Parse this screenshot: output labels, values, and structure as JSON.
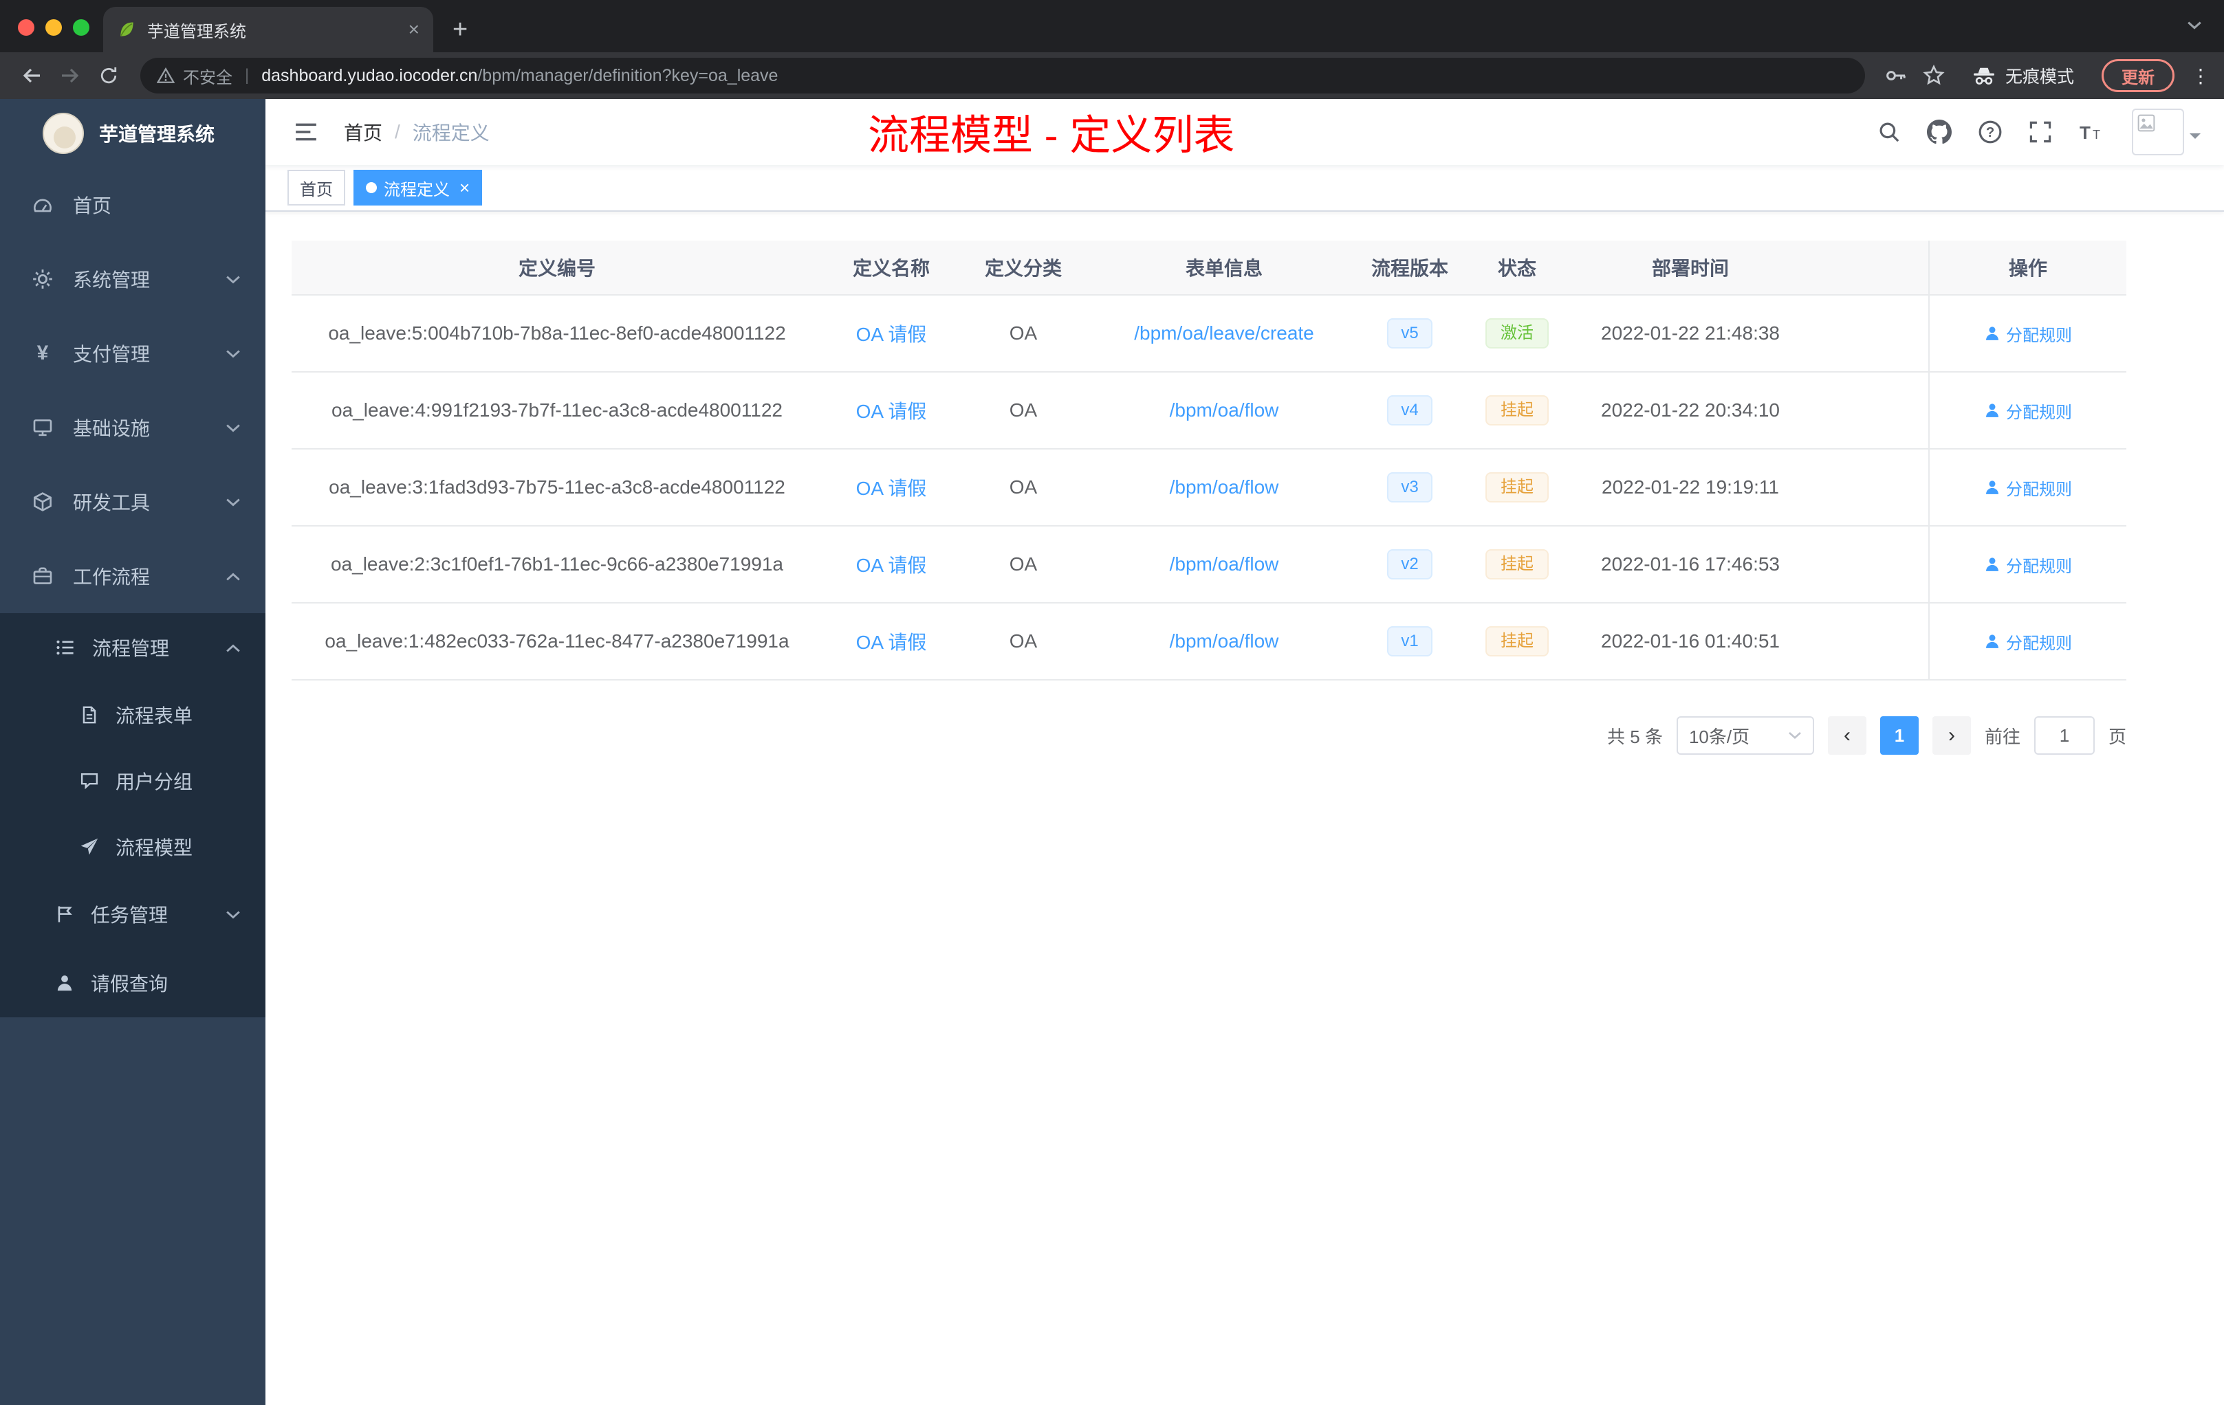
{
  "browser": {
    "tab_title": "芋道管理系统",
    "url_security": "不安全",
    "url_host": "dashboard.yudao.iocoder.cn",
    "url_path": "/bpm/manager/definition?key=oa_leave",
    "incognito_label": "无痕模式",
    "update_label": "更新"
  },
  "sidebar": {
    "logo": "芋道管理系统",
    "items": [
      {
        "label": "首页"
      },
      {
        "label": "系统管理"
      },
      {
        "label": "支付管理"
      },
      {
        "label": "基础设施"
      },
      {
        "label": "研发工具"
      },
      {
        "label": "工作流程"
      }
    ],
    "process_mgmt": "流程管理",
    "process_children": [
      "流程表单",
      "用户分组",
      "流程模型"
    ],
    "task_mgmt": "任务管理",
    "leave_query": "请假查询"
  },
  "header": {
    "breadcrumb_home": "首页",
    "breadcrumb_current": "流程定义",
    "title": "流程模型 - 定义列表"
  },
  "tags": [
    {
      "label": "首页",
      "active": false
    },
    {
      "label": "流程定义",
      "active": true
    }
  ],
  "table": {
    "columns": [
      "定义编号",
      "定义名称",
      "定义分类",
      "表单信息",
      "流程版本",
      "状态",
      "部署时间",
      "操作"
    ],
    "rows": [
      {
        "id": "oa_leave:5:004b710b-7b8a-11ec-8ef0-acde48001122",
        "name": "OA 请假",
        "category": "OA",
        "form": "/bpm/oa/leave/create",
        "version": "v5",
        "status": "激活",
        "status_type": "success",
        "time": "2022-01-22 21:48:38",
        "action": "分配规则"
      },
      {
        "id": "oa_leave:4:991f2193-7b7f-11ec-a3c8-acde48001122",
        "name": "OA 请假",
        "category": "OA",
        "form": "/bpm/oa/flow",
        "version": "v4",
        "status": "挂起",
        "status_type": "warning",
        "time": "2022-01-22 20:34:10",
        "action": "分配规则"
      },
      {
        "id": "oa_leave:3:1fad3d93-7b75-11ec-a3c8-acde48001122",
        "name": "OA 请假",
        "category": "OA",
        "form": "/bpm/oa/flow",
        "version": "v3",
        "status": "挂起",
        "status_type": "warning",
        "time": "2022-01-22 19:19:11",
        "action": "分配规则"
      },
      {
        "id": "oa_leave:2:3c1f0ef1-76b1-11ec-9c66-a2380e71991a",
        "name": "OA 请假",
        "category": "OA",
        "form": "/bpm/oa/flow",
        "version": "v2",
        "status": "挂起",
        "status_type": "warning",
        "time": "2022-01-16 17:46:53",
        "action": "分配规则"
      },
      {
        "id": "oa_leave:1:482ec033-762a-11ec-8477-a2380e71991a",
        "name": "OA 请假",
        "category": "OA",
        "form": "/bpm/oa/flow",
        "version": "v1",
        "status": "挂起",
        "status_type": "warning",
        "time": "2022-01-16 01:40:51",
        "action": "分配规则"
      }
    ]
  },
  "pagination": {
    "total": "共 5 条",
    "page_size": "10条/页",
    "current_page": "1",
    "goto_label": "前往",
    "goto_value": "1",
    "page_unit": "页"
  },
  "colors": {
    "accent": "#409eff",
    "success": "#67c23a",
    "warning": "#e6a23c",
    "title_red": "#ff0000",
    "sidebar_bg": "#304156",
    "sidebar_sub_bg": "#1f2d3d"
  }
}
